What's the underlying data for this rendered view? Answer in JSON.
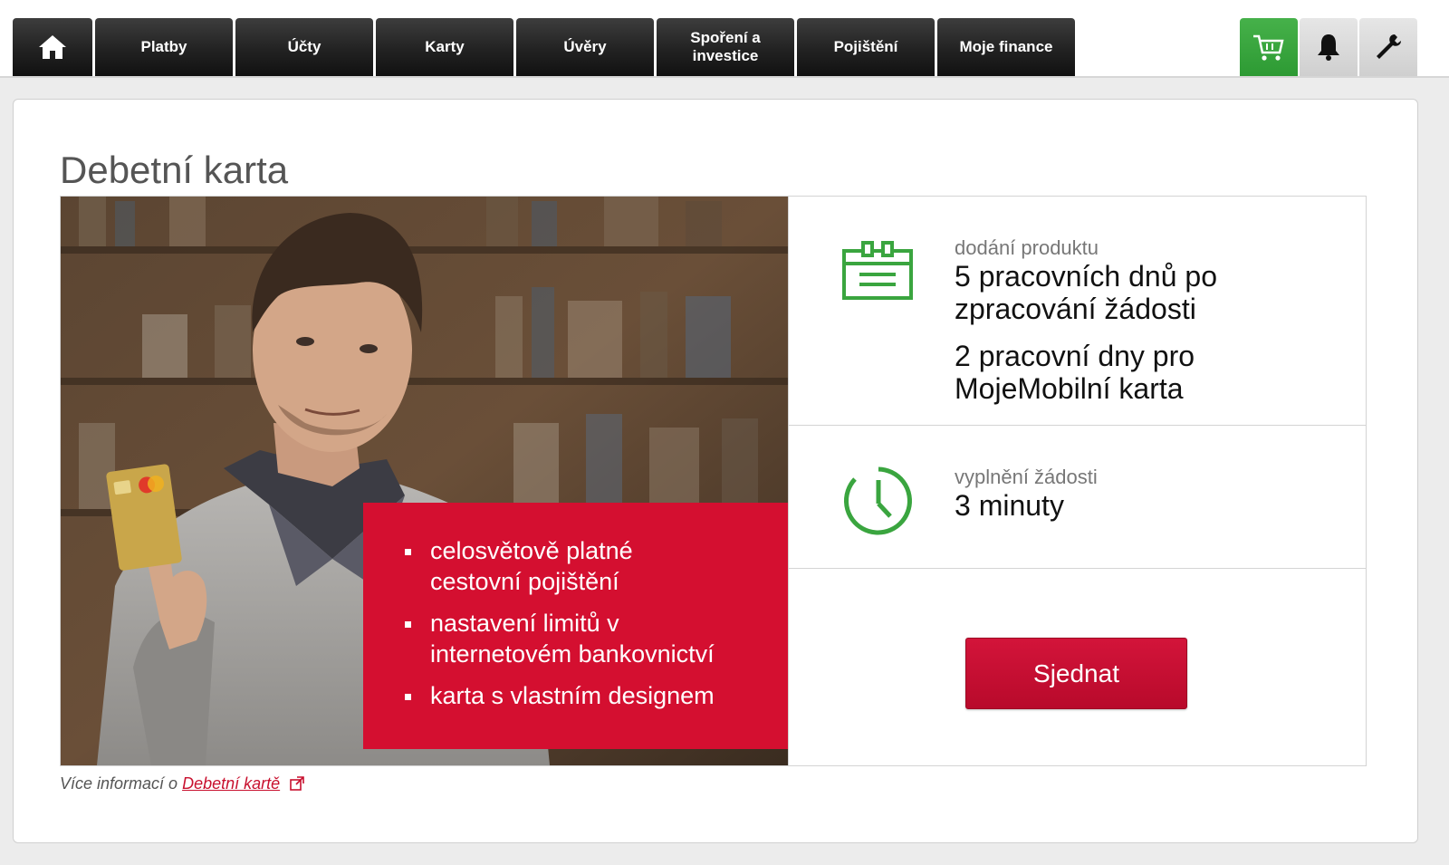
{
  "nav": {
    "home_icon": "home-icon",
    "items": [
      {
        "label": "Platby"
      },
      {
        "label": "Účty"
      },
      {
        "label": "Karty"
      },
      {
        "label": "Úvěry"
      },
      {
        "label": "Spoření a investice"
      },
      {
        "label": "Pojištění"
      },
      {
        "label": "Moje finance"
      }
    ],
    "tools": [
      "cart-icon",
      "bell-icon",
      "wrench-icon"
    ]
  },
  "page": {
    "title": "Debetní karta"
  },
  "promo": {
    "bullets": [
      "celosvětově platné cestovní pojištění",
      "nastavení limitů v internetovém bankovnictví",
      "karta s vlastním designem"
    ]
  },
  "info": {
    "delivery": {
      "label": "dodání produktu",
      "value1": "5 pracovních dnů po zpracování žádosti",
      "value2": "2 pracovní dny pro MojeMobilní karta"
    },
    "fill": {
      "label": "vyplnění žádosti",
      "value": "3 minuty"
    },
    "cta": "Sjednat"
  },
  "footer": {
    "prefix": "Více informací o",
    "link": "Debetní kartě"
  },
  "colors": {
    "accent_red": "#d40f30",
    "green": "#3aa53f",
    "nav_dark": "#222222"
  }
}
